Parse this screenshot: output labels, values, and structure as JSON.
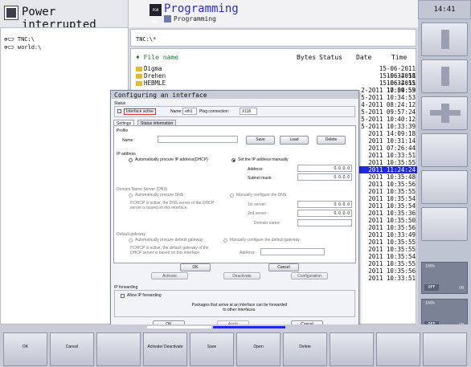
{
  "header": {
    "mode_title": "Power interrupted",
    "program_ico": "PGM MGT",
    "program_title": "Programming",
    "program_sub": "Programming",
    "clock": "14:41"
  },
  "tree": [
    "TNC:\\",
    "world:\\"
  ],
  "file_manager": {
    "path": "TNC:\\*",
    "columns": {
      "name": "File name",
      "bytes": "Bytes",
      "status": "Status",
      "date": "Date",
      "time": "Time"
    },
    "files": [
      "Digma",
      "Drehen",
      "HEBMLE"
    ],
    "dates": [
      "15-06-2011 10:34:58",
      "15-06-2011 10:34:55",
      "15-06-2011 10:34:53",
      "2-2011 17:09:59",
      "5-2011 10:34:53",
      "4-2011 08:24:12",
      "5-2011 09:57:24",
      "5-2011 10:40:12",
      "5-2011 10:33:39",
      "2011 14:09:18",
      "2011 10:31:14",
      "2011 07:26:44",
      "2011 10:33:51",
      "2011 10:35:55",
      "2011 11:24:24",
      "2011 10:35:48",
      "2011 10:35:56",
      "2011 10:35:55",
      "2011 10:35:54",
      "2011 10:35:54",
      "2011 10:35:36",
      "2011 10:35:50",
      "2011 10:35:56",
      "2011 10:33:49",
      "2011 10:35:55",
      "2011 10:35:55",
      "2011 10:35:54",
      "2011 10:35:55",
      "2011 10:35:56",
      "2011 10:33:51"
    ],
    "selected_index": 14
  },
  "dialog": {
    "title": "Configuring an interface",
    "status_label": "Status",
    "interface_active": "Interface active",
    "name_label": "Name:",
    "name_value": "eth1",
    "plug_label": "Plug connection:",
    "plug_value": "X116",
    "tabs": [
      "Settings",
      "Status information"
    ],
    "profile_label": "Profile",
    "profile_name_label": "Name:",
    "profile_buttons": [
      "Save",
      "Load",
      "Delete"
    ],
    "ip_label": "IP address",
    "ip_auto": "Automatically procure IP address(DHCP)",
    "ip_manual": "Set the IP address manually",
    "address_label": "Address:",
    "address_value": "0. 0. 0. 0",
    "mask_label": "Subnet mask:",
    "mask_value": "0. 0. 0. 0",
    "dns_label": "Domain Name Server (DNS)",
    "dns_auto": "Automatically procure DNS",
    "dns_manual": "Manually configure the DNS",
    "dns_note": "If DHCP is active, the DNS server of the DHCP server is based on this interface.",
    "server1_label": "1st server:",
    "server1_value": "0. 0. 0. 0",
    "server2_label": "2nd server:",
    "server2_value": "0. 0. 0. 0",
    "domain_label": "Domain name:",
    "gw_label": "Default gateway",
    "gw_auto": "Automatically procure default gateway",
    "gw_manual": "Manually configure the default gateway",
    "gw_note": "If DHCP is active, the default gateway of the DHCP server is based on this interface.",
    "gw_address_label": "Address:",
    "ok": "OK",
    "cancel": "Cancel",
    "under_buttons": [
      "Activate",
      "Deactivate",
      "Configuration"
    ],
    "fwd_label": "IP forwarding",
    "fwd_allow": "Allow IP forwarding",
    "fwd_note": "Packages that arrive at an interface can be forwarded to other interfaces.",
    "outer_ok": "OK",
    "outer_apply": "Apply",
    "outer_cancel": "Cancel"
  },
  "side": {
    "dark1": {
      "title": "100%",
      "off": "OFF",
      "on": "ON"
    },
    "dark2": {
      "title": "100%",
      "off": "OFF",
      "on": "ON"
    }
  },
  "softkeys": [
    "OK",
    "Cancel",
    "",
    "Activate/ Deactivate",
    "Save",
    "Open",
    "Delete",
    "",
    "",
    ""
  ]
}
